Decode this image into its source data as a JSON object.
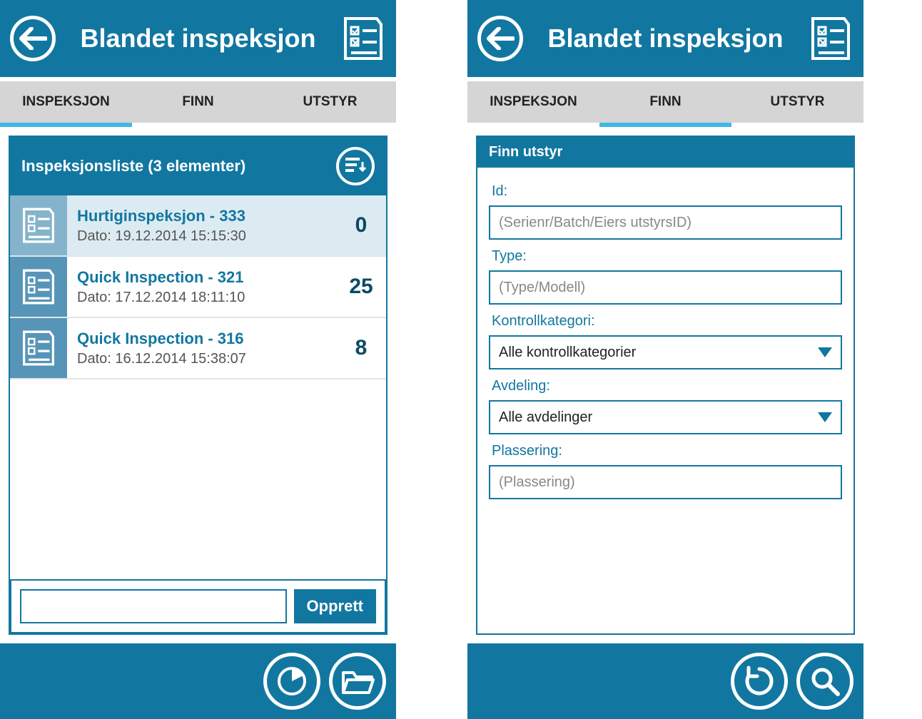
{
  "left": {
    "header_title": "Blandet inspeksjon",
    "tabs": [
      "INSPEKSJON",
      "FINN",
      "UTSTYR"
    ],
    "active_tab": 0,
    "panel_title": "Inspeksjonsliste (3 elementer)",
    "items": [
      {
        "title": "Hurtiginspeksjon - 333",
        "date": "Dato: 19.12.2014 15:15:30",
        "count": "0",
        "selected": true
      },
      {
        "title": "Quick Inspection - 321",
        "date": "Dato: 17.12.2014 18:11:10",
        "count": "25",
        "selected": false
      },
      {
        "title": "Quick Inspection - 316",
        "date": "Dato: 16.12.2014 15:38:07",
        "count": "8",
        "selected": false
      }
    ],
    "create_input": "",
    "create_label": "Opprett"
  },
  "right": {
    "header_title": "Blandet inspeksjon",
    "tabs": [
      "INSPEKSJON",
      "FINN",
      "UTSTYR"
    ],
    "active_tab": 1,
    "panel_title": "Finn utstyr",
    "form": {
      "id_label": "Id:",
      "id_placeholder": "(Serienr/Batch/Eiers utstyrsID)",
      "type_label": "Type:",
      "type_placeholder": "(Type/Modell)",
      "kategori_label": "Kontrollkategori:",
      "kategori_value": "Alle kontrollkategorier",
      "avdeling_label": "Avdeling:",
      "avdeling_value": "Alle avdelinger",
      "plassering_label": "Plassering:",
      "plassering_placeholder": "(Plassering)"
    }
  }
}
